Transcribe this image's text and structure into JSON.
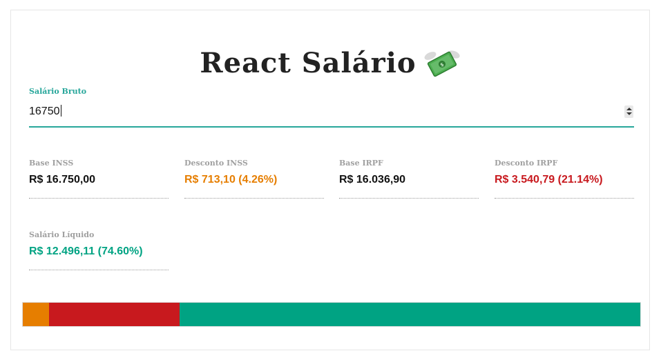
{
  "app": {
    "title": "React Salário"
  },
  "input": {
    "label": "Salário Bruto",
    "value": "16750"
  },
  "stats": {
    "base_inss": {
      "label": "Base INSS",
      "value": "R$ 16.750,00"
    },
    "desconto_inss": {
      "label": "Desconto INSS",
      "value": "R$ 713,10 (4.26%)"
    },
    "base_irpf": {
      "label": "Base IRPF",
      "value": "R$ 16.036,90"
    },
    "desconto_irpf": {
      "label": "Desconto IRPF",
      "value": "R$ 3.540,79 (21.14%)"
    },
    "salario_liquido": {
      "label": "Salário Líquido",
      "value": "R$ 12.496,11 (74.60%)"
    }
  },
  "colors": {
    "inss": "#e67e00",
    "irpf": "#c8191e",
    "liquido": "#00a383",
    "base": "#111111",
    "accent": "#26a69a"
  },
  "bar": [
    {
      "name": "inss",
      "percent": 4.26,
      "color": "#e67e00"
    },
    {
      "name": "irpf",
      "percent": 21.14,
      "color": "#c8191e"
    },
    {
      "name": "liquido",
      "percent": 74.6,
      "color": "#00a383"
    }
  ],
  "icons": {
    "title_emoji": "money-with-wings-icon",
    "spinner": "number-spinner-icon"
  }
}
